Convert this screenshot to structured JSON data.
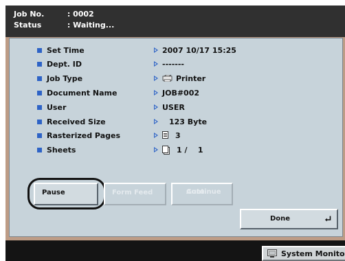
{
  "header": {
    "job_no_label": "Job No.",
    "job_no_value": ": 0002",
    "status_label": "Status",
    "status_value": ": Waiting..."
  },
  "info": [
    {
      "label": "Set Time",
      "value": "2007 10/17 15:25"
    },
    {
      "label": "Dept. ID",
      "value": "-------"
    },
    {
      "label": "Job Type",
      "value": "Printer",
      "icon": "printer-icon"
    },
    {
      "label": "Document Name",
      "value": "JOB#002"
    },
    {
      "label": "User",
      "value": "USER"
    },
    {
      "label": "Received Size",
      "value": "123 Byte"
    },
    {
      "label": "Rasterized Pages",
      "value": "3",
      "icon": "document-icon"
    },
    {
      "label": "Sheets",
      "value": "1 /    1",
      "icon": "sheets-icon"
    }
  ],
  "buttons": {
    "pause": "Pause",
    "form_feed": "Form Feed",
    "auto_continue_line1": "Auto",
    "auto_continue_line2": "Continue",
    "done": "Done",
    "done_icon": "enter-icon"
  },
  "system_monitor": {
    "label": "System Monitor",
    "icon": "monitor-icon"
  },
  "colors": {
    "bullet": "#2e63c6",
    "panel": "#c7d3da",
    "frame_brown": "#bd9c86",
    "header": "#303030"
  }
}
